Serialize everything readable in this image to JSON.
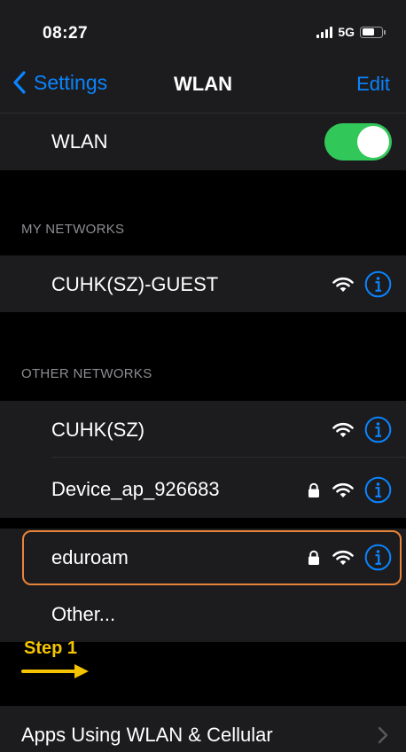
{
  "status": {
    "time": "08:27",
    "network": "5G"
  },
  "nav": {
    "back_label": "Settings",
    "title": "WLAN",
    "edit_label": "Edit"
  },
  "wlan_toggle": {
    "label": "WLAN",
    "on": true
  },
  "my_networks": {
    "header": "MY NETWORKS",
    "items": [
      {
        "name": "CUHK(SZ)-GUEST",
        "locked": false
      }
    ]
  },
  "other_networks": {
    "header": "OTHER NETWORKS",
    "items": [
      {
        "name": "CUHK(SZ)",
        "locked": false
      },
      {
        "name": "Device_ap_926683",
        "locked": true
      },
      {
        "name": "eduroam",
        "locked": true
      },
      {
        "name": "Other...",
        "locked": false
      }
    ]
  },
  "annotation": {
    "step_label": "Step 1",
    "highlighted_network": "eduroam"
  },
  "apps_row": {
    "label": "Apps Using WLAN & Cellular"
  },
  "colors": {
    "accent": "#0a84ff",
    "toggle_on": "#32c759",
    "highlight": "#e8843a",
    "step": "#f5c400"
  }
}
